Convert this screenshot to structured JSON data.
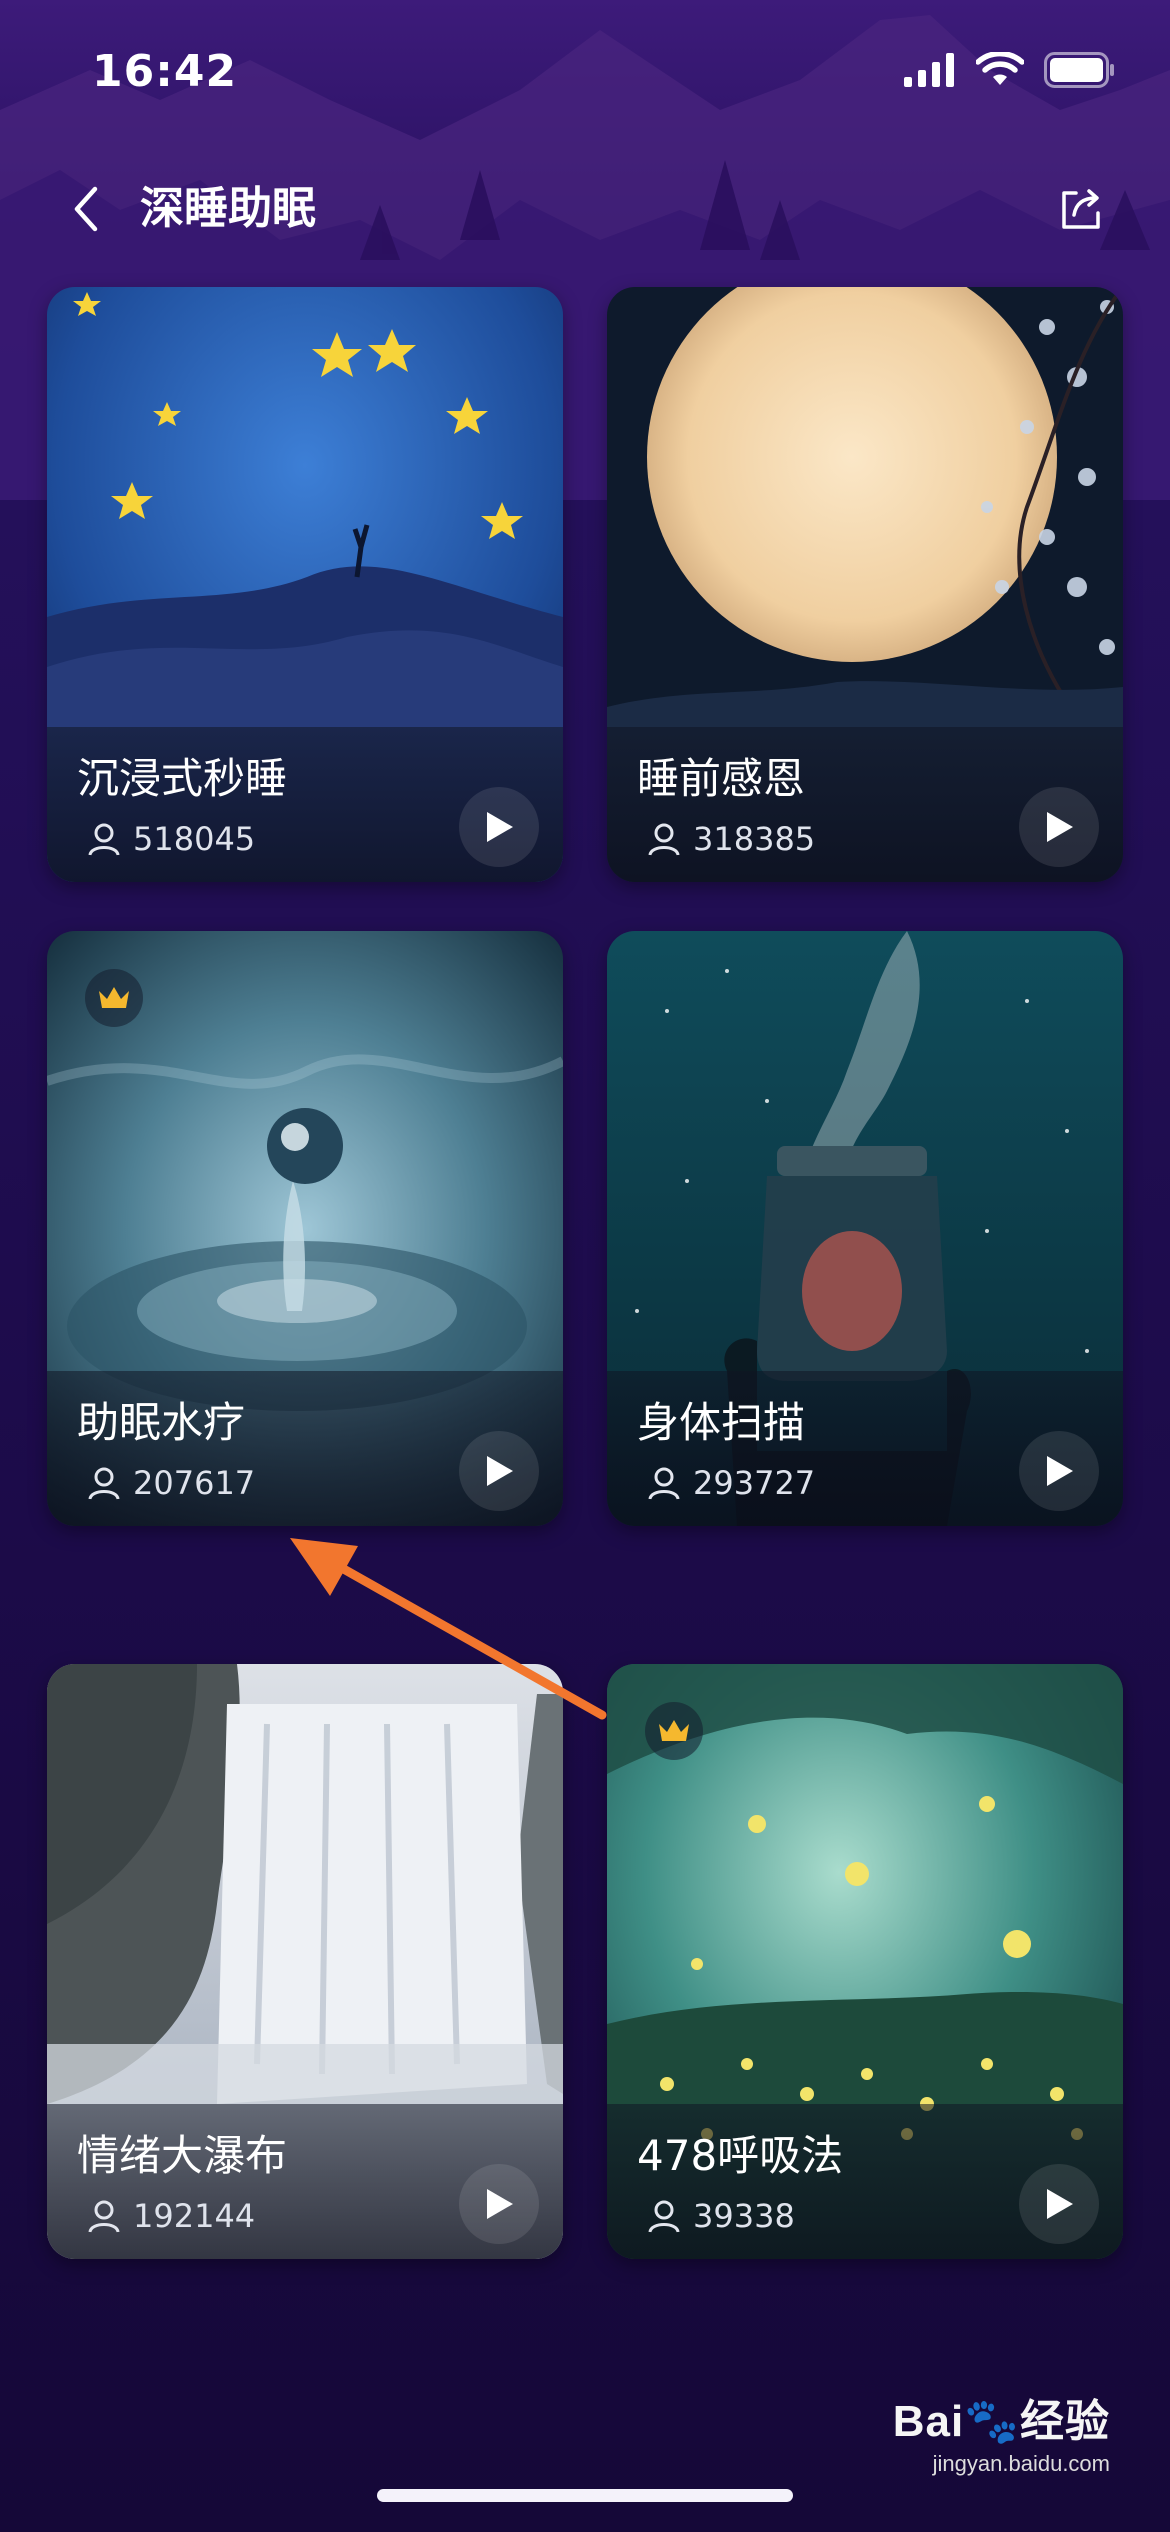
{
  "status_bar": {
    "time": "16:42"
  },
  "nav": {
    "title": "深睡助眠"
  },
  "cards": [
    {
      "title": "沉浸式秒睡",
      "count": "518045",
      "premium": false,
      "scene": "moon-stars"
    },
    {
      "title": "睡前感恩",
      "count": "318385",
      "premium": false,
      "scene": "full-moon-blossom"
    },
    {
      "title": "助眠水疗",
      "count": "207617",
      "premium": true,
      "scene": "water-drop"
    },
    {
      "title": "身体扫描",
      "count": "293727",
      "premium": false,
      "scene": "starry-jar"
    },
    {
      "title": "情绪大瀑布",
      "count": "192144",
      "premium": false,
      "scene": "waterfall"
    },
    {
      "title": "478呼吸法",
      "count": "39338",
      "premium": true,
      "scene": "firefly-forest"
    }
  ],
  "watermark": {
    "brand": "Bai",
    "brand_cn": "经验",
    "url": "jingyan.baidu.com"
  },
  "colors": {
    "background": "#24105a",
    "annotation_arrow": "#f2762e",
    "crown": "#f5b82e"
  }
}
